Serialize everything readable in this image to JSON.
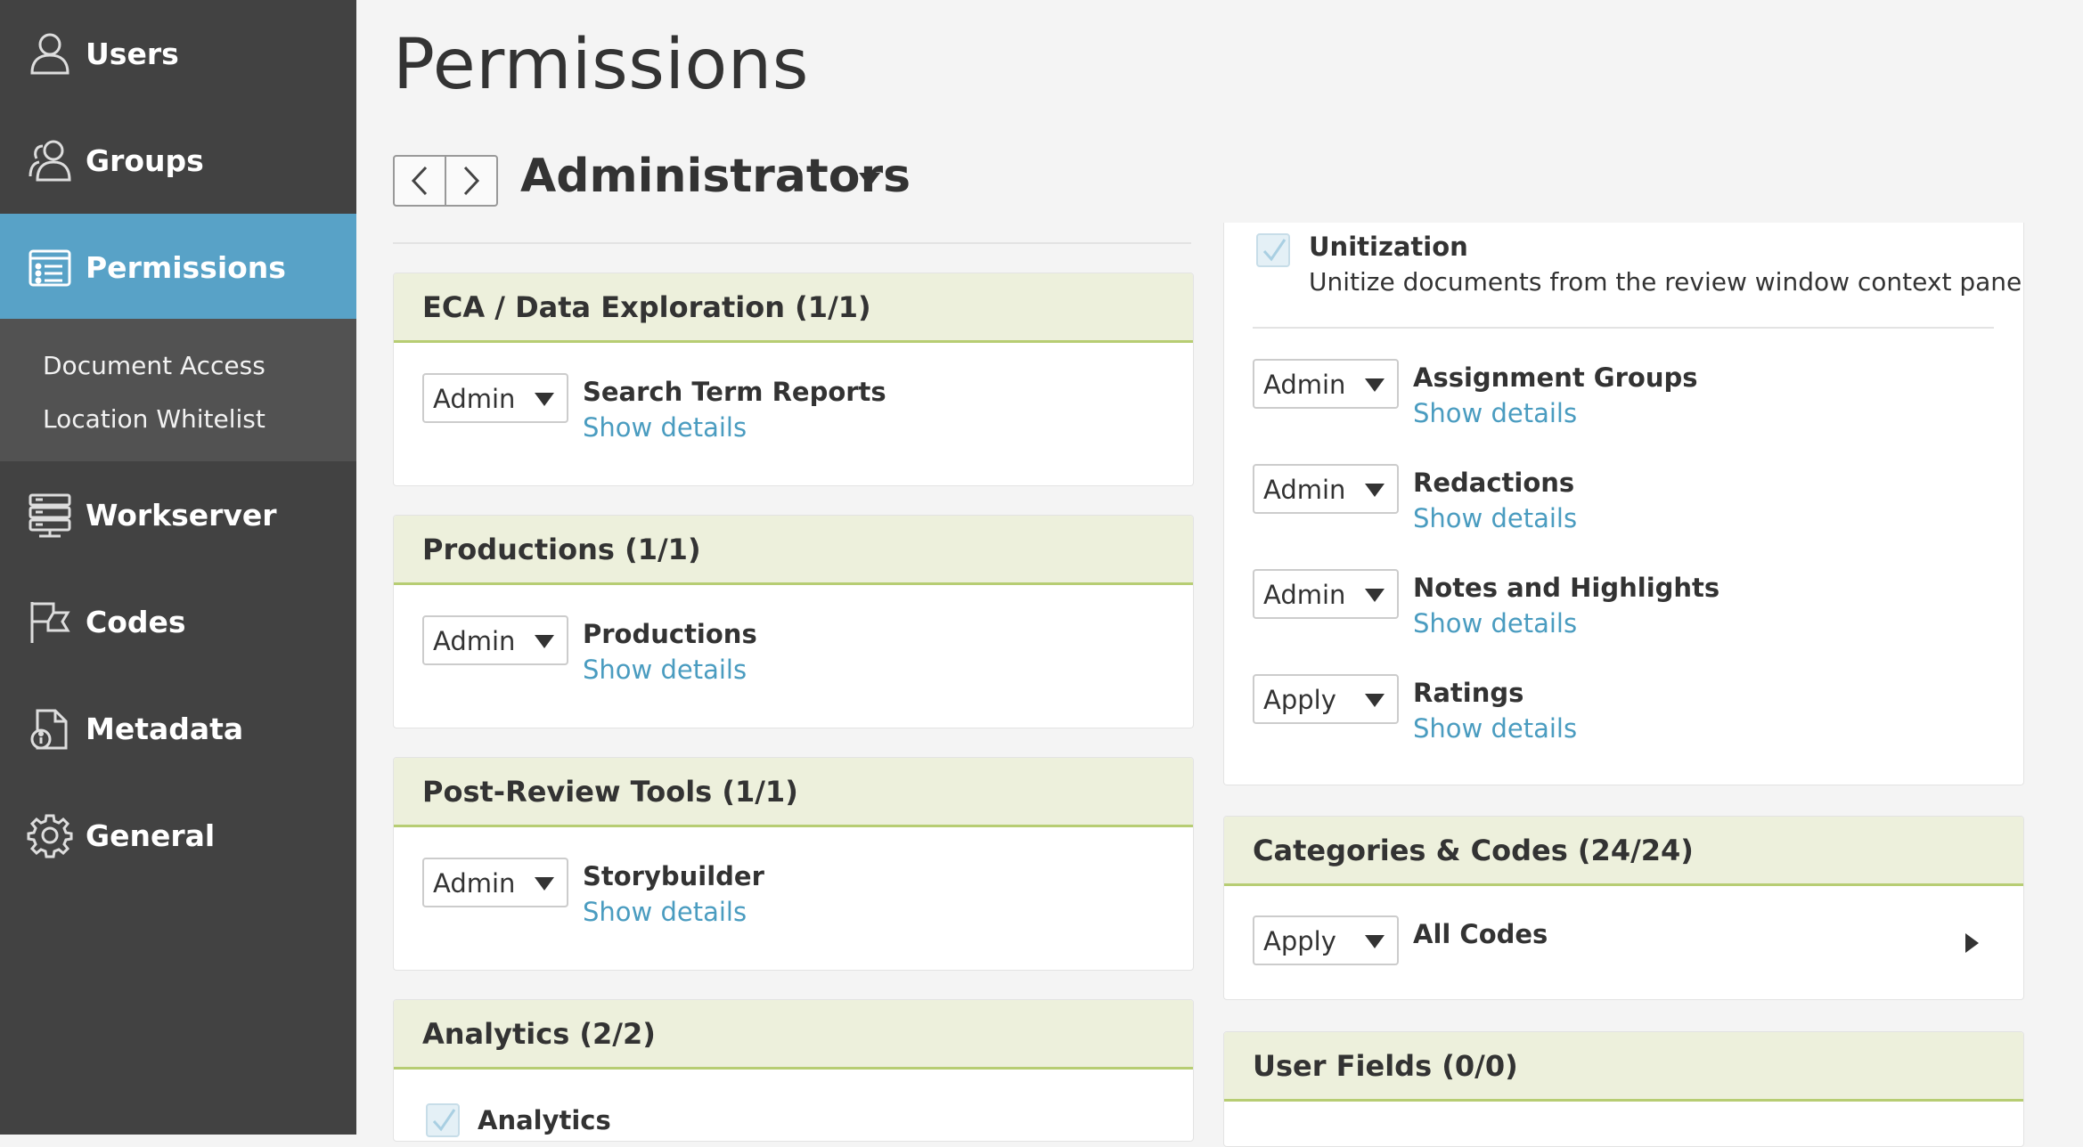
{
  "sidebar": {
    "items": [
      {
        "label": "Users",
        "icon": "user-icon"
      },
      {
        "label": "Groups",
        "icon": "group-icon"
      },
      {
        "label": "Permissions",
        "icon": "list-icon"
      },
      {
        "label": "Workserver",
        "icon": "server-icon"
      },
      {
        "label": "Codes",
        "icon": "flag-icon"
      },
      {
        "label": "Metadata",
        "icon": "document-info-icon"
      },
      {
        "label": "General",
        "icon": "gear-icon"
      }
    ],
    "subitems": [
      {
        "label": "Document Access"
      },
      {
        "label": "Location Whitelist"
      }
    ],
    "active_color": "#58a2c7"
  },
  "header": {
    "title": "Permissions",
    "group_name": "Administrators"
  },
  "left_panels": {
    "eca": {
      "title": "ECA / Data Exploration (1/1)",
      "rows": [
        {
          "access": "Admin",
          "name": "Search Term Reports",
          "link": "Show details"
        }
      ]
    },
    "productions": {
      "title": "Productions (1/1)",
      "rows": [
        {
          "access": "Admin",
          "name": "Productions",
          "link": "Show details"
        }
      ]
    },
    "post_review": {
      "title": "Post-Review Tools (1/1)",
      "rows": [
        {
          "access": "Admin",
          "name": "Storybuilder",
          "link": "Show details"
        }
      ]
    },
    "analytics": {
      "title": "Analytics (2/2)",
      "rows": [
        {
          "name": "Analytics",
          "checked": true
        }
      ]
    }
  },
  "right_panels": {
    "review": {
      "unitization": {
        "name": "Unitization",
        "desc": "Unitize documents from the review window context panel",
        "checked": true
      },
      "rows": [
        {
          "access": "Admin",
          "name": "Assignment Groups",
          "link": "Show details"
        },
        {
          "access": "Admin",
          "name": "Redactions",
          "link": "Show details"
        },
        {
          "access": "Admin",
          "name": "Notes and Highlights",
          "link": "Show details"
        },
        {
          "access": "Apply",
          "name": "Ratings",
          "link": "Show details"
        }
      ]
    },
    "categories": {
      "title": "Categories & Codes (24/24)",
      "rows": [
        {
          "access": "Apply",
          "name": "All Codes"
        }
      ]
    },
    "user_fields": {
      "title": "User Fields (0/0)"
    }
  },
  "colors": {
    "sidebar_bg": "#424242",
    "panel_header_bg": "#edf0dc",
    "panel_header_border": "#b7cd73",
    "link": "#4a9cc0"
  }
}
